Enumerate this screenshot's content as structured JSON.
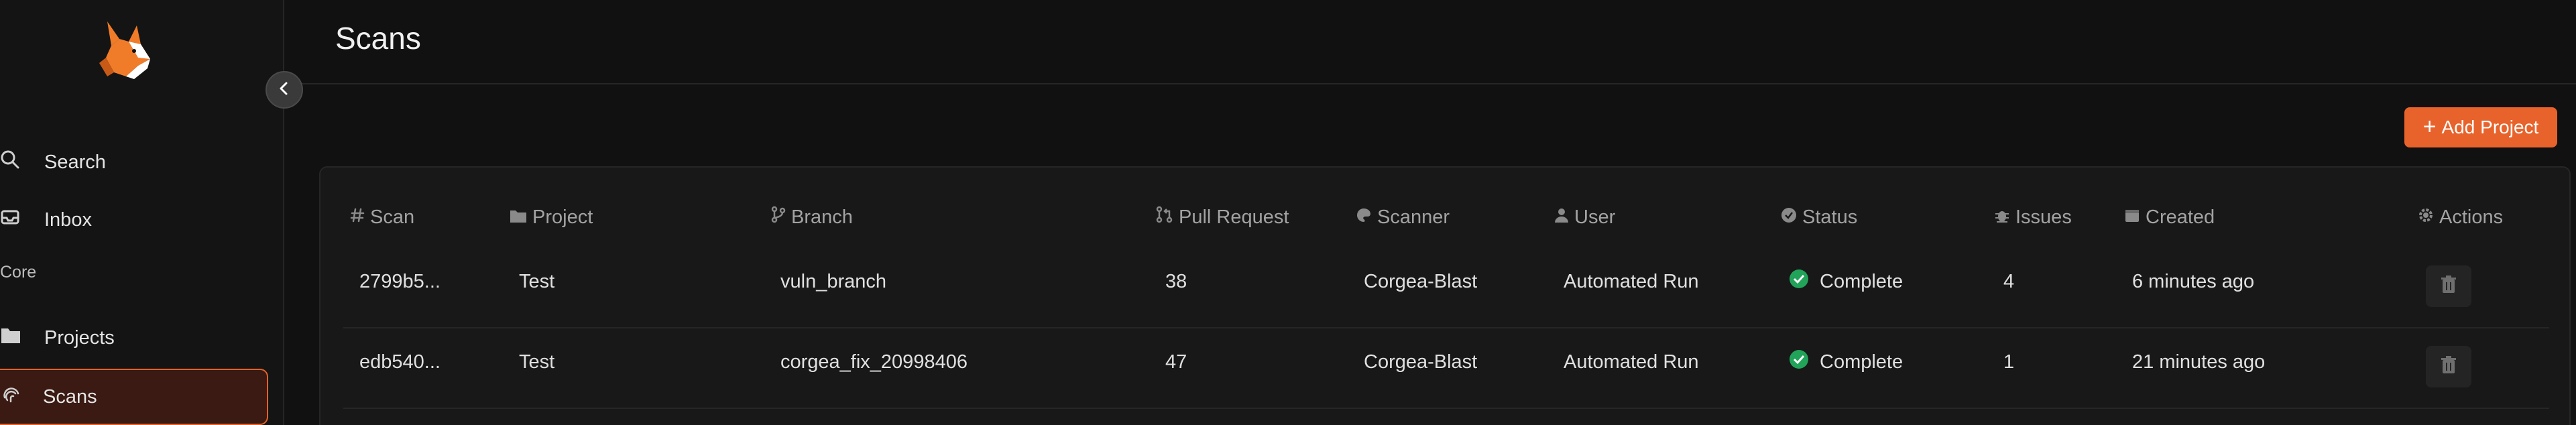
{
  "sidebar": {
    "nav_search": "Search",
    "nav_inbox": "Inbox",
    "section_core": "Core",
    "nav_projects": "Projects",
    "nav_scans": "Scans"
  },
  "header": {
    "title": "Scans"
  },
  "toolbar": {
    "add_project_label": "Add Project"
  },
  "table": {
    "columns": {
      "scan": "Scan",
      "project": "Project",
      "branch": "Branch",
      "pull_request": "Pull Request",
      "scanner": "Scanner",
      "user": "User",
      "status": "Status",
      "issues": "Issues",
      "created": "Created",
      "actions": "Actions"
    },
    "rows": [
      {
        "scan": "2799b5...",
        "project": "Test",
        "branch": "vuln_branch",
        "pull_request": "38",
        "scanner": "Corgea-Blast",
        "user": "Automated Run",
        "status": "Complete",
        "issues": "4",
        "created": "6 minutes ago"
      },
      {
        "scan": "edb540...",
        "project": "Test",
        "branch": "corgea_fix_20998406",
        "pull_request": "47",
        "scanner": "Corgea-Blast",
        "user": "Automated Run",
        "status": "Complete",
        "issues": "1",
        "created": "21 minutes ago"
      }
    ]
  },
  "colors": {
    "accent": "#e8632b",
    "status_complete": "#22a35a",
    "background": "#111111"
  },
  "icons": [
    "fox-logo-icon",
    "chevron-left-icon",
    "search-icon",
    "inbox-icon",
    "folder-icon",
    "fingerprint-icon",
    "hash-icon",
    "branch-icon",
    "pull-request-icon",
    "palette-icon",
    "user-icon",
    "check-badge-icon",
    "bug-icon",
    "calendar-icon",
    "gear-icon",
    "trash-icon",
    "plus-icon"
  ]
}
